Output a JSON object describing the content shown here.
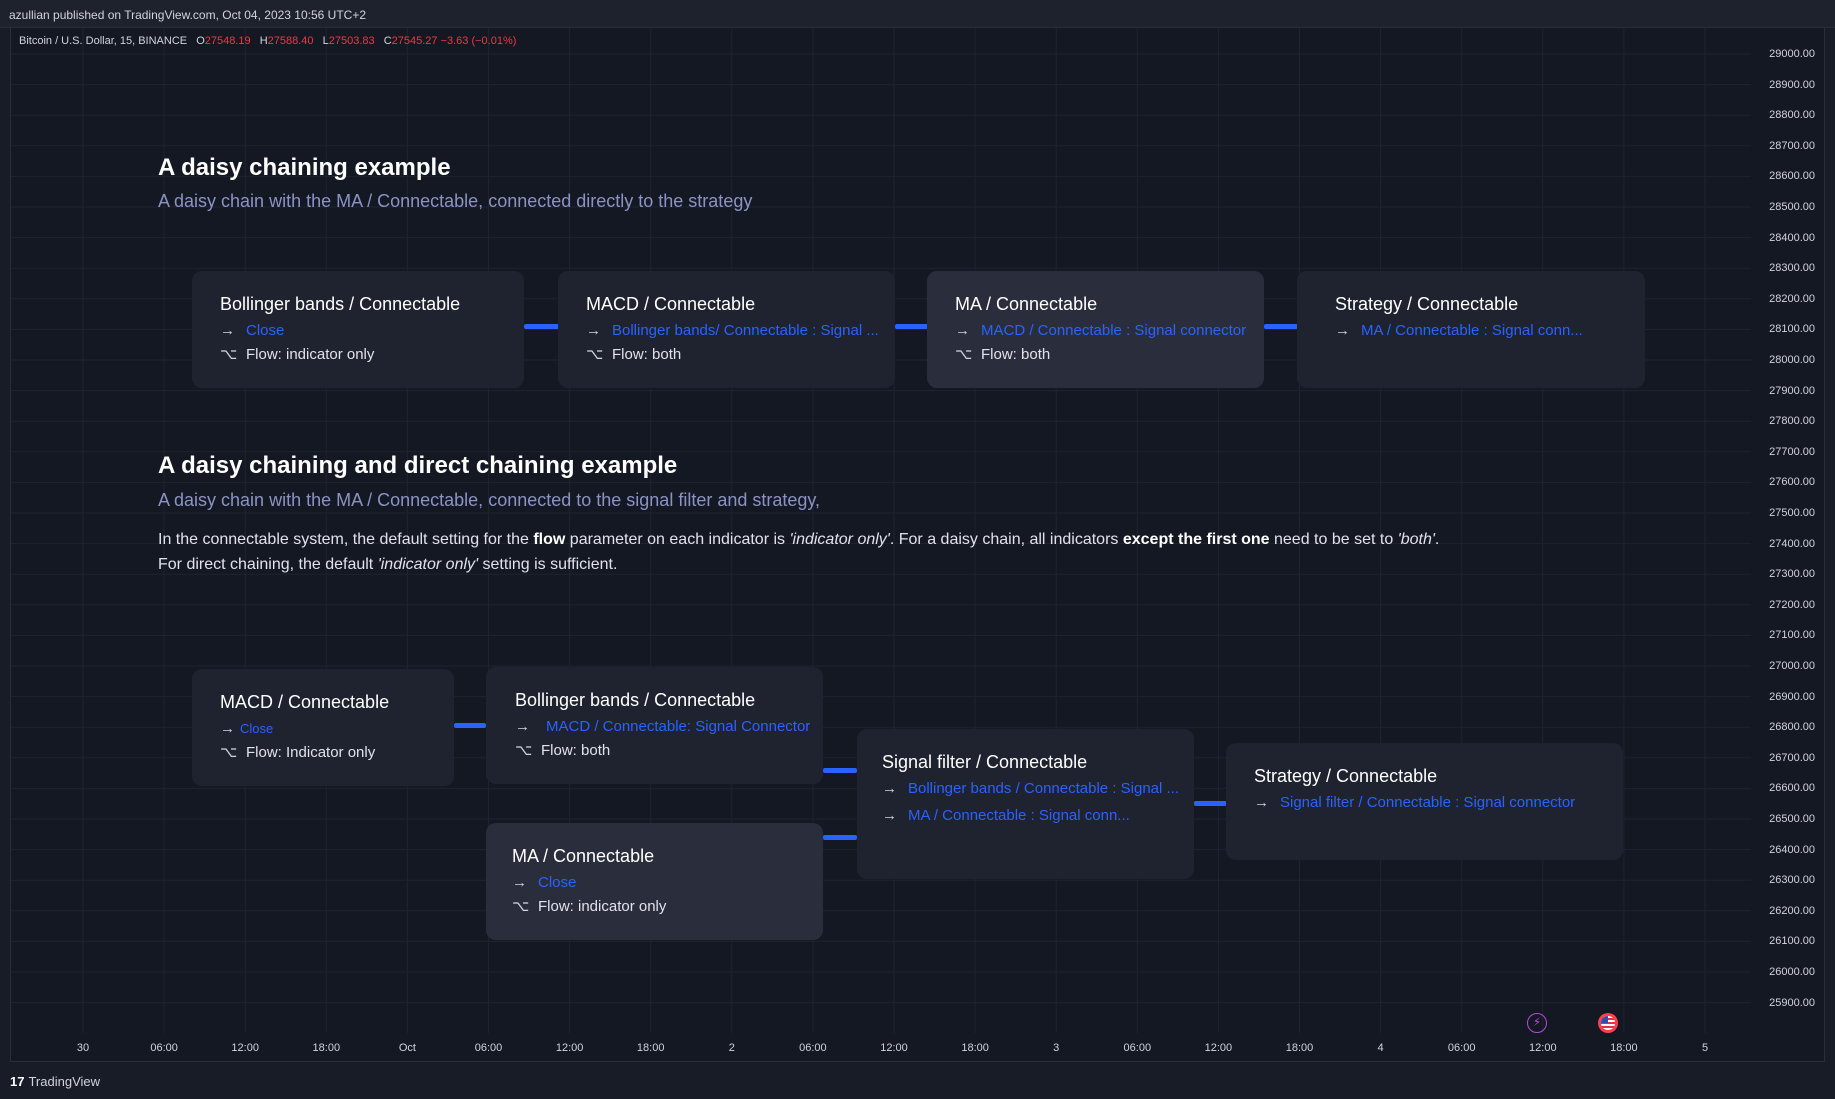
{
  "header": {
    "published": "azullian published on TradingView.com, Oct 04, 2023 10:56 UTC+2"
  },
  "ohlc": {
    "symbol": "Bitcoin / U.S. Dollar, 15, BINANCE",
    "o_label": "O",
    "o": "27548.19",
    "h_label": "H",
    "h": "27588.40",
    "l_label": "L",
    "l": "27503.83",
    "c_label": "C",
    "c": "27545.27 −3.63 (−0.01%)"
  },
  "price_axis": [
    "29000.00",
    "28900.00",
    "28800.00",
    "28700.00",
    "28600.00",
    "28500.00",
    "28400.00",
    "28300.00",
    "28200.00",
    "28100.00",
    "28000.00",
    "27900.00",
    "27800.00",
    "27700.00",
    "27600.00",
    "27500.00",
    "27400.00",
    "27300.00",
    "27200.00",
    "27100.00",
    "27000.00",
    "26900.00",
    "26800.00",
    "26700.00",
    "26600.00",
    "26500.00",
    "26400.00",
    "26300.00",
    "26200.00",
    "26100.00",
    "26000.00",
    "25900.00"
  ],
  "time_axis": [
    "30",
    "06:00",
    "12:00",
    "18:00",
    "Oct",
    "06:00",
    "12:00",
    "18:00",
    "2",
    "06:00",
    "12:00",
    "18:00",
    "3",
    "06:00",
    "12:00",
    "18:00",
    "4",
    "06:00",
    "12:00",
    "18:00",
    "5"
  ],
  "section1": {
    "title": "A daisy chaining example",
    "subtitle": "A daisy chain with the MA / Connectable,  connected directly to the strategy",
    "cards": [
      {
        "title": "Bollinger bands / Connectable",
        "input": "Close",
        "flow": "Flow: indicator only"
      },
      {
        "title": "MACD / Connectable",
        "input": "Bollinger bands/ Connectable : Signal ...",
        "flow": "Flow: both"
      },
      {
        "title": "MA / Connectable",
        "input": "MACD / Connectable : Signal connector",
        "flow": "Flow: both"
      },
      {
        "title": "Strategy / Connectable",
        "input": "MA / Connectable : Signal conn..."
      }
    ]
  },
  "section2": {
    "title": "A daisy chaining and direct chaining example",
    "subtitle": "A daisy chain with the MA / Connectable,  connected to the signal filter and strategy,",
    "para1": {
      "a": "In the connectable system, the default setting for the ",
      "b": "flow",
      "c": " parameter on each indicator is ",
      "d": "'indicator only'",
      "e": ". For a daisy chain, all indicators ",
      "f": "except the first one",
      "g": " need to be set to ",
      "h": "'both'",
      "i": "."
    },
    "para2": {
      "a": "For direct chaining, the default ",
      "b": "'indicator only'",
      "c": " setting is sufficient."
    },
    "cards": {
      "macd": {
        "title": "MACD / Connectable",
        "input": "Close",
        "flow": "Flow: Indicator only"
      },
      "bb": {
        "title": "Bollinger bands / Connectable",
        "input": "MACD / Connectable: Signal Connector",
        "flow": "Flow: both"
      },
      "ma": {
        "title": "MA / Connectable",
        "input": "Close",
        "flow": "Flow: indicator only"
      },
      "filter": {
        "title": "Signal filter / Connectable",
        "input1": "Bollinger bands / Connectable : Signal ...",
        "input2": "MA / Connectable : Signal conn..."
      },
      "strategy": {
        "title": "Strategy / Connectable",
        "input": "Signal filter / Connectable : Signal connector"
      }
    }
  },
  "icons": {
    "arrow": "→",
    "flow": "⌥",
    "flash": "⚡"
  },
  "footer": {
    "logo_mark": "17",
    "logo_text": "TradingView"
  }
}
